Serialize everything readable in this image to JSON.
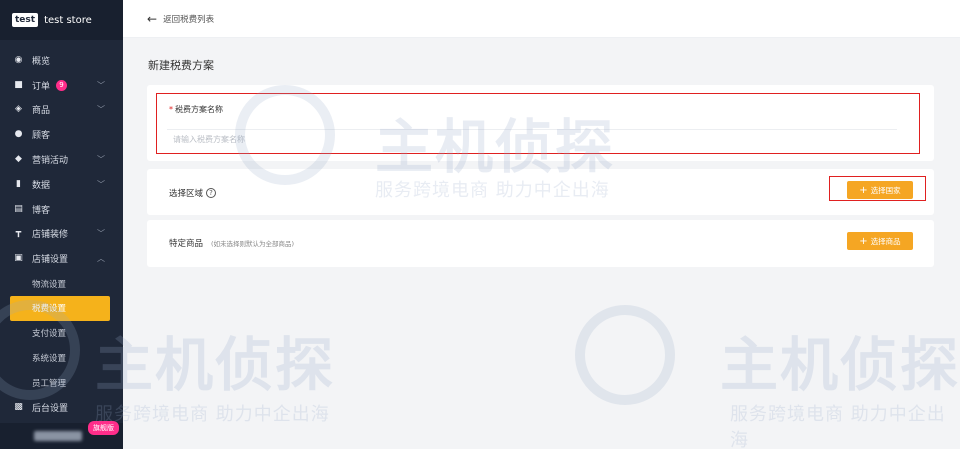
{
  "brand": {
    "logo": "test",
    "name": "test store"
  },
  "sidebar": {
    "items": [
      {
        "label": "概览",
        "icon": "dashboard-icon"
      },
      {
        "label": "订单",
        "icon": "order-icon",
        "badge": "9",
        "expandable": true
      },
      {
        "label": "商品",
        "icon": "product-icon",
        "expandable": true
      },
      {
        "label": "顾客",
        "icon": "customer-icon"
      },
      {
        "label": "营销活动",
        "icon": "tag-icon",
        "expandable": true
      },
      {
        "label": "数据",
        "icon": "chart-icon",
        "expandable": true
      },
      {
        "label": "博客",
        "icon": "blog-icon"
      },
      {
        "label": "店铺装修",
        "icon": "brush-icon",
        "expandable": true
      },
      {
        "label": "店铺设置",
        "icon": "store-icon",
        "expanded": true
      }
    ],
    "sub_items": [
      "物流设置",
      "税费设置",
      "支付设置",
      "系统设置",
      "员工管理"
    ],
    "active_sub": "税费设置",
    "bottom_item": {
      "label": "后台设置",
      "icon": "settings-icon"
    },
    "edition_badge": "旗舰版"
  },
  "topbar": {
    "back_label": "返回税费列表"
  },
  "page": {
    "title": "新建税费方案",
    "name_field": {
      "label": "税费方案名称",
      "placeholder": "请输入税费方案名称"
    },
    "region": {
      "label": "选择区域",
      "button": "选择国家"
    },
    "goods": {
      "label": "特定商品",
      "hint": "(如未选择则默认为全部商品)",
      "button": "选择商品"
    }
  },
  "watermark": {
    "title": "主机侦探",
    "slogan": "服务跨境电商 助力中企出海"
  },
  "colors": {
    "sidebar_bg": "#1f2839",
    "accent": "#f5a623",
    "active": "#f5b21b",
    "highlight": "#e02020",
    "badge": "#ff2d8a"
  }
}
